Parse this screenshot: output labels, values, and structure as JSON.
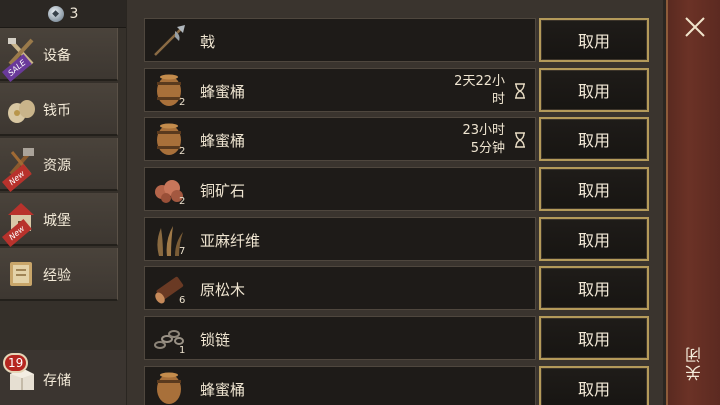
{
  "header": {
    "gem_count": "3"
  },
  "sidebar": {
    "items": [
      {
        "label": "设备",
        "icon": "weapons-icon",
        "ribbon": "SALE"
      },
      {
        "label": "钱币",
        "icon": "coin-bags-icon",
        "ribbon": ""
      },
      {
        "label": "资源",
        "icon": "tools-icon",
        "ribbon": "New"
      },
      {
        "label": "城堡",
        "icon": "castle-icon",
        "ribbon": "New"
      },
      {
        "label": "经验",
        "icon": "book-icon",
        "ribbon": ""
      }
    ],
    "storage": {
      "label": "存储",
      "badge": "19",
      "icon": "chest-icon"
    }
  },
  "items": [
    {
      "name": "戟",
      "qty": "",
      "icon": "halberd-icon",
      "timer": [],
      "button": "取用"
    },
    {
      "name": "蜂蜜桶",
      "qty": "2",
      "icon": "barrel-icon",
      "timer": [
        "2天22小",
        "时"
      ],
      "button": "取用"
    },
    {
      "name": "蜂蜜桶",
      "qty": "2",
      "icon": "barrel-icon",
      "timer": [
        "23小时",
        "5分钟"
      ],
      "button": "取用"
    },
    {
      "name": "铜矿石",
      "qty": "2",
      "icon": "copper-ore-icon",
      "timer": [],
      "button": "取用"
    },
    {
      "name": "亚麻纤维",
      "qty": "7",
      "icon": "flax-fiber-icon",
      "timer": [],
      "button": "取用"
    },
    {
      "name": "原松木",
      "qty": "6",
      "icon": "pine-log-icon",
      "timer": [],
      "button": "取用"
    },
    {
      "name": "锁链",
      "qty": "1",
      "icon": "chain-icon",
      "timer": [],
      "button": "取用"
    },
    {
      "name": "蜂蜜桶",
      "qty": "",
      "icon": "barrel-icon",
      "timer": [],
      "button": "取用"
    }
  ],
  "close": {
    "label": "关闭"
  },
  "colors": {
    "button_border": "#b49a5a",
    "close_bar": "#6b3226",
    "badge": "#b52620"
  }
}
